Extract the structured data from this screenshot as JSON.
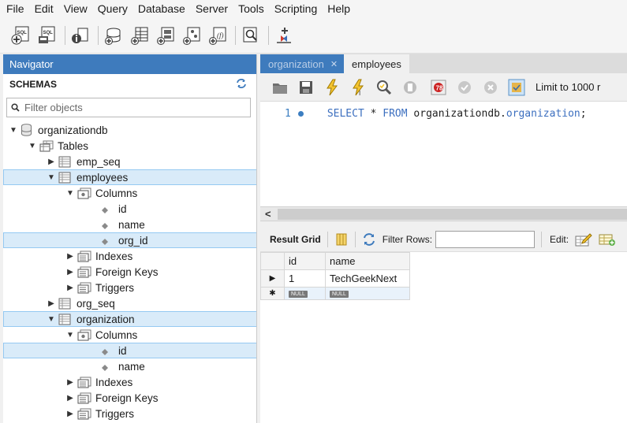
{
  "menu": [
    "File",
    "Edit",
    "View",
    "Query",
    "Database",
    "Server",
    "Tools",
    "Scripting",
    "Help"
  ],
  "toolbar_icons": [
    "new-sql-tab-icon",
    "open-sql-script-icon",
    "inspector-icon",
    "create-schema-icon",
    "create-table-icon",
    "create-view-icon",
    "create-procedure-icon",
    "create-function-icon",
    "search-table-data-icon",
    "reconnect-icon"
  ],
  "navigator": {
    "title": "Navigator",
    "schemas_label": "SCHEMAS",
    "filter_placeholder": "Filter objects",
    "tree": {
      "db": "organizationdb",
      "tables": "Tables",
      "emp_seq": "emp_seq",
      "employees": "employees",
      "columns": "Columns",
      "col_id": "id",
      "col_name": "name",
      "col_org_id": "org_id",
      "indexes": "Indexes",
      "foreign_keys": "Foreign Keys",
      "triggers": "Triggers",
      "org_seq": "org_seq",
      "organization": "organization",
      "columns2": "Columns",
      "col2_id": "id",
      "col2_name": "name",
      "indexes2": "Indexes",
      "foreign_keys2": "Foreign Keys",
      "triggers2": "Triggers"
    }
  },
  "editor": {
    "tabs": [
      {
        "label": "organization"
      },
      {
        "label": "employees"
      }
    ],
    "limit_label": "Limit to 1000 r",
    "line_number": "1",
    "sql": {
      "kw1": "SELECT",
      "star": " * ",
      "kw2": "FROM",
      "schema": " organizationdb.",
      "table": "organization",
      "end": ";"
    }
  },
  "results": {
    "result_grid_label": "Result Grid",
    "filter_rows_label": "Filter Rows:",
    "edit_label": "Edit:",
    "columns": [
      "id",
      "name"
    ],
    "rows": [
      {
        "id": "1",
        "name": "TechGeekNext"
      }
    ],
    "null_label": "NULL"
  },
  "colors": {
    "accent": "#3e7bbd",
    "selection": "#d9ebf9",
    "keyword": "#3c6fbf"
  }
}
